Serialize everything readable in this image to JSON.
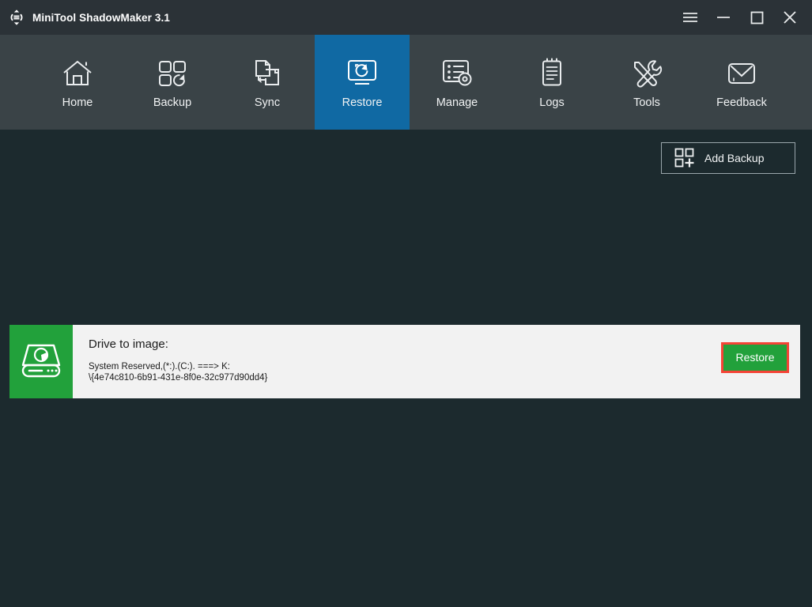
{
  "window": {
    "title": "MiniTool ShadowMaker 3.1",
    "logo_icon": "shadowmaker-logo-icon",
    "controls": [
      {
        "name": "menu-button",
        "icon": "hamburger-menu-icon",
        "label": "Menu"
      },
      {
        "name": "minimize-button",
        "icon": "minimize-icon",
        "label": "Minimize"
      },
      {
        "name": "maximize-button",
        "icon": "maximize-icon",
        "label": "Maximize"
      },
      {
        "name": "close-button",
        "icon": "close-icon",
        "label": "Close"
      }
    ]
  },
  "nav": {
    "active": "Restore",
    "active_color": "#1069a3",
    "bar_color": "#3a4347",
    "items": [
      {
        "label": "Home",
        "icon": "home-icon"
      },
      {
        "label": "Backup",
        "icon": "backup-grid-refresh-icon"
      },
      {
        "label": "Sync",
        "icon": "sync-files-icon"
      },
      {
        "label": "Restore",
        "icon": "restore-monitor-icon"
      },
      {
        "label": "Manage",
        "icon": "manage-list-gear-icon"
      },
      {
        "label": "Logs",
        "icon": "logs-clipboard-icon"
      },
      {
        "label": "Tools",
        "icon": "tools-wrench-screwdriver-icon"
      },
      {
        "label": "Feedback",
        "icon": "feedback-envelope-icon"
      }
    ]
  },
  "toolbar": {
    "add_backup_label": "Add Backup",
    "add_backup_icon": "add-backup-icon"
  },
  "backups": [
    {
      "thumb_icon": "hard-drive-icon",
      "thumb_color": "#22a13b",
      "title": "Drive to image:",
      "details": " System Reserved,(*:).(C:). ===> K:\n\\{4e74c810-6b91-431e-8f0e-32c977d90dd4}",
      "action_label": "Restore",
      "action_color": "#22a13b",
      "highlight_color": "#f44336"
    }
  ]
}
